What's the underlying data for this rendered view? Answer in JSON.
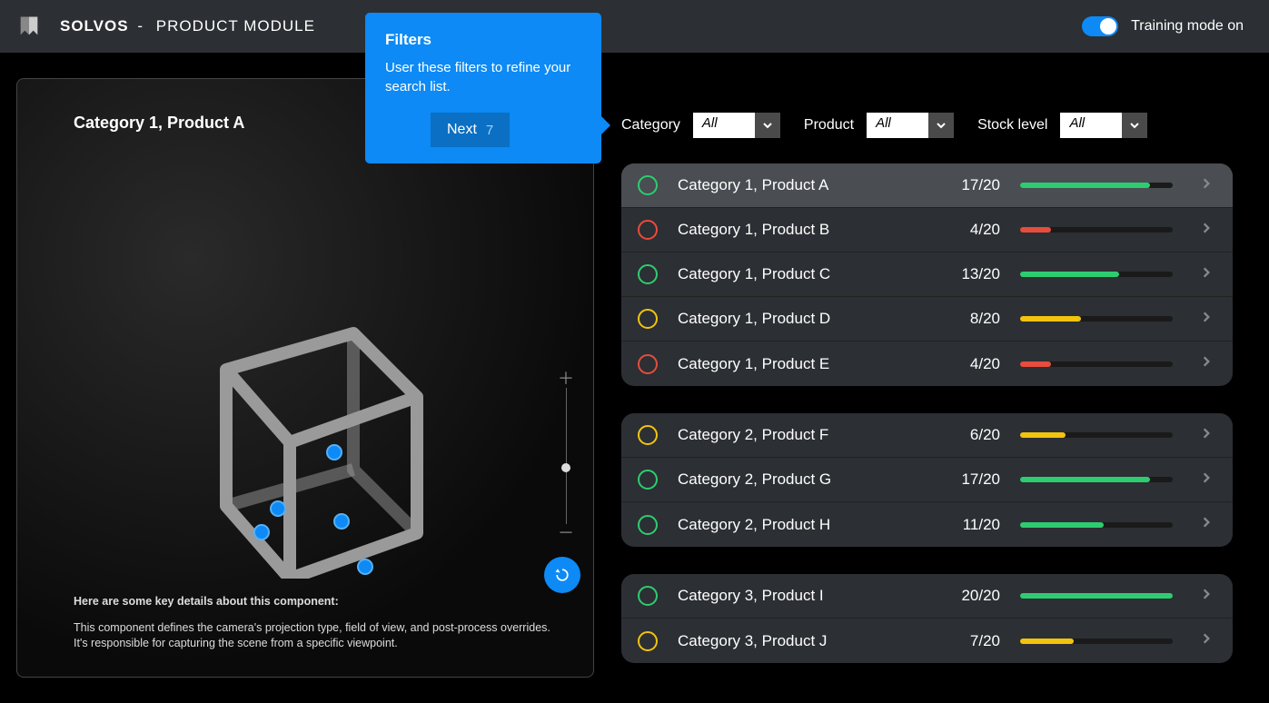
{
  "header": {
    "brand_main": "SOLVOS",
    "brand_sep": "-",
    "brand_sub": "PRODUCT MODULE",
    "training_label": "Training mode on",
    "training_on": true
  },
  "tooltip": {
    "title": "Filters",
    "body": "User these filters to refine your search list.",
    "next_label": "Next",
    "step": "7"
  },
  "viewer": {
    "title": "Category 1, Product A",
    "desc_heading": "Here are some key details about this component:",
    "desc_body": "This component defines the camera's projection type, field of view, and post-process overrides. It's responsible for capturing the scene from a specific viewpoint."
  },
  "filters": {
    "category_label": "Category",
    "category_value": "All",
    "product_label": "Product",
    "product_value": "All",
    "stock_label": "Stock level",
    "stock_value": "All"
  },
  "colors": {
    "green": "#2ecc71",
    "red": "#e74c3c",
    "yellow": "#f1c40f"
  },
  "groups": [
    {
      "rows": [
        {
          "name": "Category 1, Product A",
          "count": "17/20",
          "pct": 85,
          "status": "green",
          "selected": true
        },
        {
          "name": "Category 1, Product B",
          "count": "4/20",
          "pct": 20,
          "status": "red",
          "selected": false
        },
        {
          "name": "Category 1, Product C",
          "count": "13/20",
          "pct": 65,
          "status": "green",
          "selected": false
        },
        {
          "name": "Category 1, Product D",
          "count": "8/20",
          "pct": 40,
          "status": "yellow",
          "selected": false
        },
        {
          "name": "Category 1, Product E",
          "count": "4/20",
          "pct": 20,
          "status": "red",
          "selected": false
        }
      ]
    },
    {
      "rows": [
        {
          "name": "Category 2, Product F",
          "count": "6/20",
          "pct": 30,
          "status": "yellow",
          "selected": false
        },
        {
          "name": "Category 2, Product G",
          "count": "17/20",
          "pct": 85,
          "status": "green",
          "selected": false
        },
        {
          "name": "Category 2, Product H",
          "count": "11/20",
          "pct": 55,
          "status": "green",
          "selected": false
        }
      ]
    },
    {
      "rows": [
        {
          "name": "Category 3, Product I",
          "count": "20/20",
          "pct": 100,
          "status": "green",
          "selected": false
        },
        {
          "name": "Category 3, Product J",
          "count": "7/20",
          "pct": 35,
          "status": "yellow",
          "selected": false
        }
      ]
    }
  ]
}
